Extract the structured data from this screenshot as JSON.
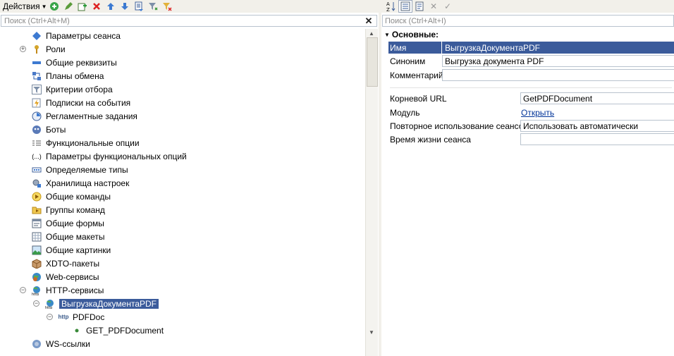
{
  "toolbar": {
    "actions_label": "Действия",
    "buttons": [
      "add-icon",
      "edit-icon",
      "copy-icon",
      "delete-icon",
      "move-up-icon",
      "move-down-icon",
      "sort-icon",
      "filter-icon",
      "clear-filter-icon"
    ]
  },
  "search_left": {
    "placeholder": "Поиск (Ctrl+Alt+M)"
  },
  "tree": {
    "items": [
      {
        "label": "Параметры сеанса",
        "icon": "session-params-icon"
      },
      {
        "label": "Роли",
        "icon": "role-key-icon"
      },
      {
        "label": "Общие реквизиты",
        "icon": "common-attributes-icon"
      },
      {
        "label": "Планы обмена",
        "icon": "exchange-plans-icon"
      },
      {
        "label": "Критерии отбора",
        "icon": "filter-criteria-icon"
      },
      {
        "label": "Подписки на события",
        "icon": "event-subscriptions-icon"
      },
      {
        "label": "Регламентные задания",
        "icon": "scheduled-jobs-icon"
      },
      {
        "label": "Боты",
        "icon": "bots-icon"
      },
      {
        "label": "Функциональные опции",
        "icon": "functional-options-icon"
      },
      {
        "label": "Параметры функциональных опций",
        "icon": "functional-option-params-icon"
      },
      {
        "label": "Определяемые типы",
        "icon": "defined-types-icon"
      },
      {
        "label": "Хранилища настроек",
        "icon": "settings-storage-icon"
      },
      {
        "label": "Общие команды",
        "icon": "common-commands-icon"
      },
      {
        "label": "Группы команд",
        "icon": "command-groups-icon"
      },
      {
        "label": "Общие формы",
        "icon": "common-forms-icon"
      },
      {
        "label": "Общие макеты",
        "icon": "common-templates-icon"
      },
      {
        "label": "Общие картинки",
        "icon": "common-pictures-icon"
      },
      {
        "label": "XDTO-пакеты",
        "icon": "xdto-packages-icon"
      },
      {
        "label": "Web-сервисы",
        "icon": "web-services-icon"
      },
      {
        "label": "HTTP-сервисы",
        "icon": "http-services-icon"
      },
      {
        "label": "ВыгрузкаДокументаPDF",
        "icon": "http-service-icon"
      },
      {
        "label": "PDFDoc",
        "icon": "url-template-icon"
      },
      {
        "label": "GET_PDFDocument",
        "icon": "method-dot-icon"
      },
      {
        "label": "WS-ссылки",
        "icon": "ws-links-icon"
      }
    ]
  },
  "search_right": {
    "placeholder": "Поиск (Ctrl+Alt+I)"
  },
  "properties": {
    "group_title": "Основные:",
    "name_label": "Имя",
    "name_value": "ВыгрузкаДокументаPDF",
    "synonym_label": "Синоним",
    "synonym_value": "Выгрузка документа PDF",
    "comment_label": "Комментарий",
    "comment_value": "",
    "root_url_label": "Корневой URL",
    "root_url_value": "GetPDFDocument",
    "module_label": "Модуль",
    "module_link": "Открыть",
    "session_reuse_label": "Повторное использование сеансов",
    "session_reuse_value": "Использовать автоматически",
    "session_lifetime_label": "Время жизни сеанса",
    "session_lifetime_value": ""
  },
  "colors": {
    "selection": "#3b5b9b",
    "toolbar_bg": "#f2f0ea",
    "border": "#b9c3ce",
    "link": "#003399"
  }
}
